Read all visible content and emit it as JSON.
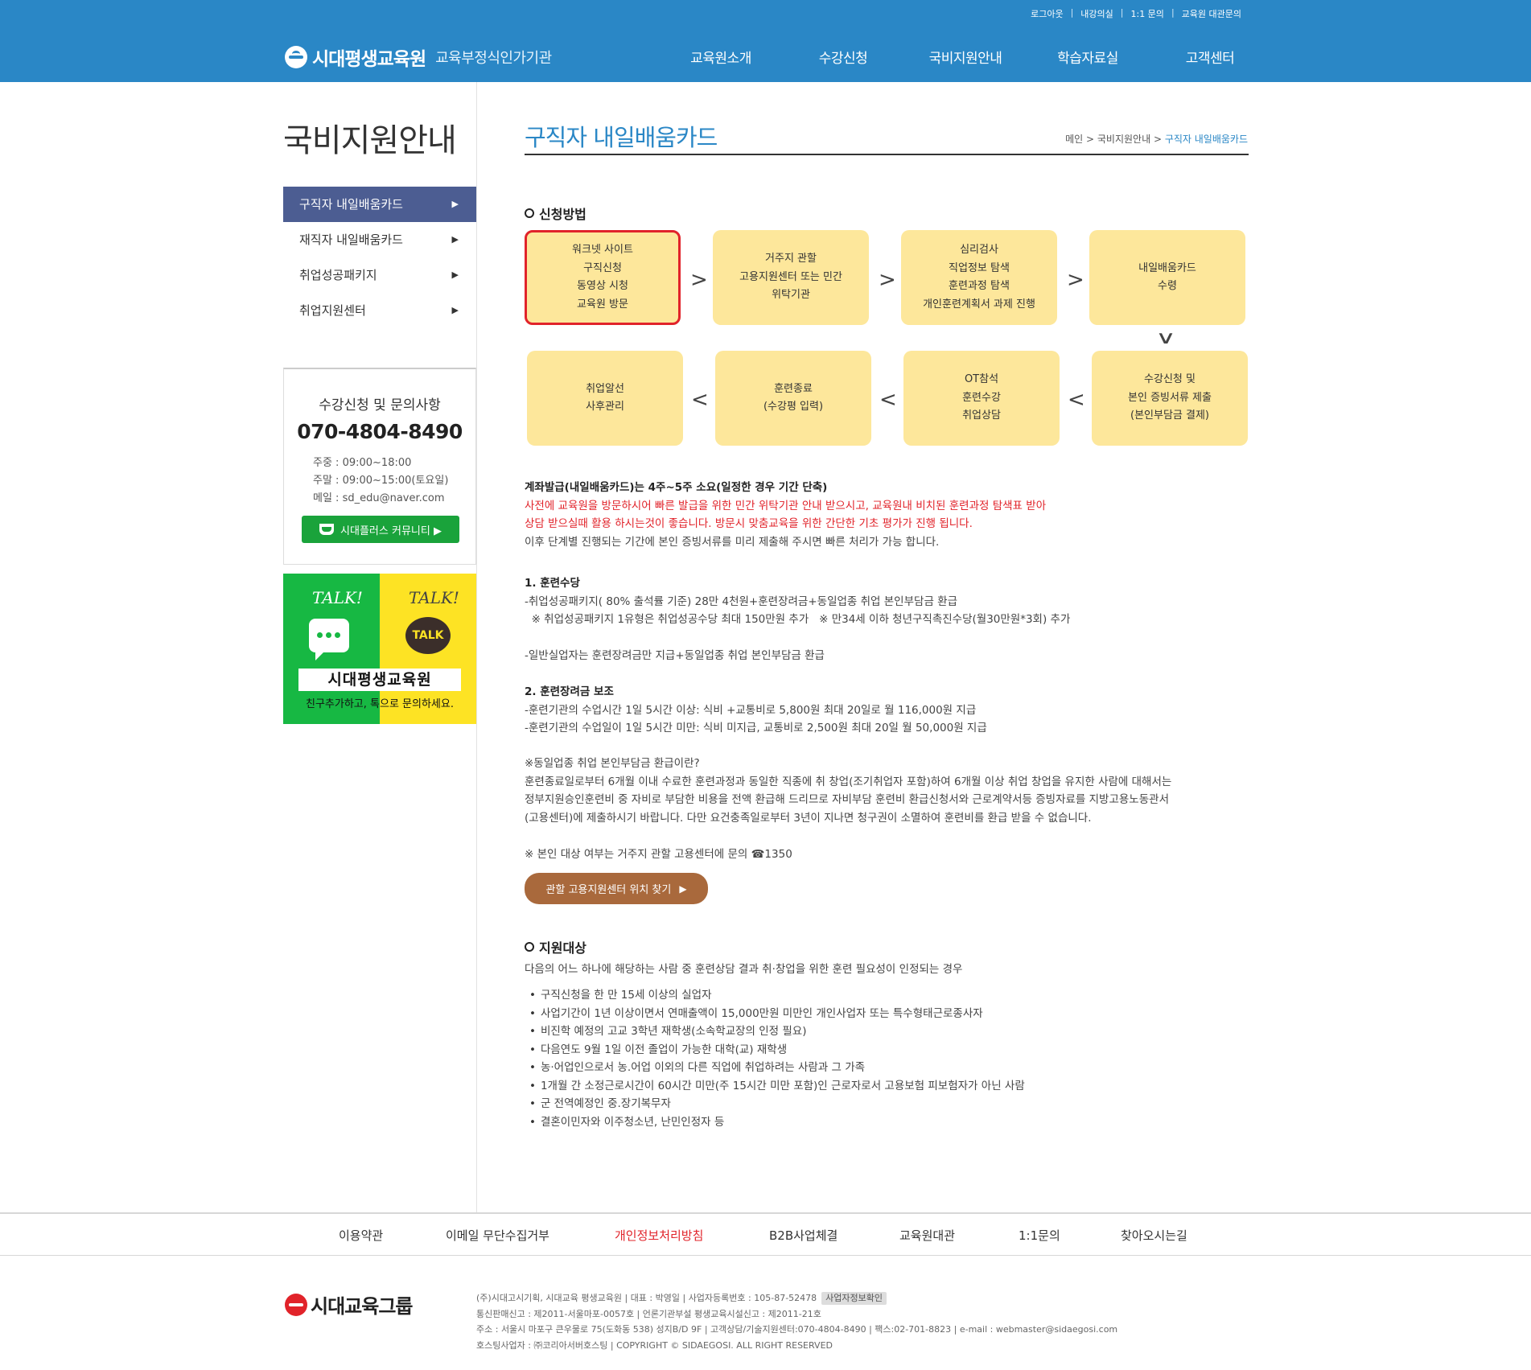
{
  "util_links": [
    "로그아웃",
    "내강의실",
    "1:1 문의",
    "교육원 대관문의"
  ],
  "header": {
    "logo_name": "시대평생교육원",
    "logo_sub": "교육부정식인가기관",
    "gnb": [
      "교육원소개",
      "수강신청",
      "국비지원안내",
      "학습자료실",
      "고객센터"
    ]
  },
  "sidebar": {
    "title": "국비지원안내",
    "items": [
      {
        "label": "구직자 내일배움카드",
        "active": true
      },
      {
        "label": "재직자 내일배움카드",
        "active": false
      },
      {
        "label": "취업성공패키지",
        "active": false
      },
      {
        "label": "취업지원센터",
        "active": false
      }
    ],
    "arrow": "▶",
    "contact": {
      "title": "수강신청 및 문의사항",
      "phone": "070-4804-8490",
      "weekday": "주중 : 09:00~18:00",
      "weekend": "주말 : 09:00~15:00(토요일)",
      "email": "메일 : sd_edu@naver.com",
      "community_btn": "시대플러스 커뮤니티 ▶"
    },
    "talk": {
      "word": "TALK!",
      "badge": "TALK",
      "name": "시대평생교육원",
      "caption": "친구추가하고, 톡으로 문의하세요."
    }
  },
  "content": {
    "title": "구직자 내일배움카드",
    "breadcrumb": {
      "home": "메인",
      "sep": " > ",
      "parent": "국비지원안내",
      "current": "구직자 내일배움카드"
    },
    "section1": "신청방법",
    "steps": [
      [
        "워크넷 사이트",
        "구직신청",
        "동영상 시청",
        "교육원 방문"
      ],
      [
        "거주지 관할",
        "고용지원센터 또는 민간",
        "위탁기관"
      ],
      [
        "심리검사",
        "직업정보 탐색",
        "훈련과정 탐색",
        "개인훈련계획서 과제 진행"
      ],
      [
        "내일배움카드",
        "수령"
      ],
      [
        "수강신청 및",
        "본인 증빙서류 제출",
        "(본인부담금 결제)"
      ],
      [
        "OT참석",
        "훈련수강",
        "취업상담"
      ],
      [
        "훈련종료",
        "(수강평 입력)"
      ],
      [
        "취업알선",
        "사후관리"
      ]
    ],
    "arrow_right": ">",
    "arrow_left": "<",
    "arrow_down": "∨",
    "issue_title": "계좌발급(내일배움카드)는 4주~5주 소요(일정한 경우 기간 단축)",
    "issue_red_1": "사전에 교육원을 방문하시어 빠른 발급을 위한 민간 위탁기관 안내 받으시고, 교육원내 비치된 훈련과정 탐색표 받아",
    "issue_red_2": "상담 받으실때 활용 하시는것이 좋습니다. 방문시 맞춤교육을 위한 간단한 기초 평가가 진행 됩니다.",
    "issue_note": "이후 단계별 진행되는 기간에 본인 증빙서류를 미리 제출해 주시면 빠른 처리가 가능 합니다.",
    "allow_title": "1. 훈련수당",
    "allow_1": "-취업성공패키지( 80% 출석률 기준) 28만 4천원+훈련장려금+동일업종 취업 본인부담금 환급",
    "allow_2": "  ※ 취업성공패키지 1유형은 취업성공수당 최대 150만원 추가   ※ 만34세 이하 청년구직촉진수당(월30만원*3회) 추가",
    "allow_3": "-일반실업자는 훈련장려금만 지급+동일업종 취업 본인부담금 환급",
    "incent_title": "2. 훈련장려금 보조",
    "incent_1": "-훈련기관의 수업시간 1일 5시간 이상: 식비 +교통비로 5,800원 최대 20일로 월 116,000원 지급",
    "incent_2": "-훈련기관의 수업일이 1일 5시간 미만: 식비 미지급, 교통비로 2,500원 최대 20일 월 50,000원 지급",
    "refund_q": "※동일업종 취업 본인부담금 환급이란?",
    "refund_1": "훈련종료일로부터 6개월 이내 수료한 훈련과정과 동일한 직종에 취 창업(조기취업자 포함)하여 6개월 이상 취업 창업을 유지한 사람에 대해서는",
    "refund_2": "정부지원승인훈련비 중 자비로 부담한 비용을 전액 환급해 드리므로 자비부담 훈련비 환급신청서와 근로계약서등 증빙자료를 지방고용노동관서",
    "refund_3": "(고용센터)에 제출하시기 바랍니다. 다만 요건충족일로부터 3년이 지나면 청구권이 소멸하여 훈련비를 환급 받을 수 없습니다.",
    "contact_note": "※ 본인 대상 여부는 거주지 관할 고용센터에 문의 ☎1350",
    "find_btn": "관할 고용지원센터 위치 찾기",
    "find_btn_icon": "▶",
    "section2": "지원대상",
    "target_intro": "다음의 어느 하나에 해당하는 사람 중 훈련상담 결과 취·창업을 위한 훈련 필요성이 인정되는 경우",
    "targets": [
      "구직신청을 한 만 15세 이상의 실업자",
      "사업기간이 1년 이상이면서 연매출액이 15,000만원 미만인 개인사업자 또는 특수형태근로종사자",
      "비진학 예정의 고교 3학년 재학생(소속학교장의 인정 필요)",
      "다음연도 9월 1일 이전 졸업이 가능한 대학(교) 재학생",
      "농·어업인으로서 농.어업 이외의 다른 직업에 취업하려는 사람과 그 가족",
      "1개월 간 소정근로시간이 60시간 미만(주 15시간 미만 포함)인 근로자로서 고용보험 피보험자가 아닌 사람",
      "군 전역예정인 중.장기복무자",
      "결혼이민자와 이주청소년, 난민인정자 등"
    ]
  },
  "footer": {
    "nav": [
      "이용약관",
      "이메일 무단수집거부",
      "개인정보처리방침",
      "B2B사업체결",
      "교육원대관",
      "1:1문의",
      "찾아오시는길"
    ],
    "logo_name": "시대교육그룹",
    "info_1": "(주)시대고시기획, 시대교육 평생교육원 | 대표 : 박영일 | 사업자등록번호 : 105-87-52478",
    "biz_btn": "사업자정보확인",
    "info_2": "통신판매신고 : 제2011-서울마포-0057호 | 언론기관부설 평생교육시설신고 : 제2011-21호",
    "info_3": "주소 : 서울시 마포구 큰우물로 75(도화동 538) 성지B/D 9F | 고객상담/기술지원센터:070-4804-8490 | 팩스:02-701-8823 | e-mail : webmaster@sidaegosi.com",
    "info_4": "호스팅사업자 : ㈜코리아서버호스팅 | COPYRIGHT © SIDAEGOSI. ALL RIGHT RESERVED"
  },
  "colors": {
    "header_blue": "#2a87c6",
    "sidebar_active": "#4c5d92",
    "step_fill": "#fde79b",
    "highlight_red": "#e1232a",
    "find_btn": "#a9693c",
    "talk_green": "#17b843",
    "talk_yellow": "#fde324"
  }
}
